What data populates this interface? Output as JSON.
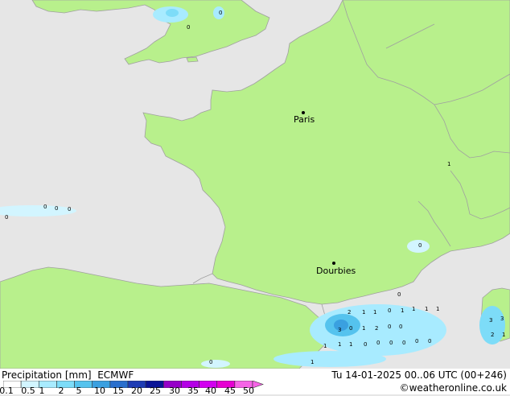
{
  "map": {
    "places": [
      {
        "name": "Paris"
      },
      {
        "name": "Dourbies"
      }
    ],
    "precip_labels": [
      "0",
      "0",
      "0",
      "0",
      "0",
      "0",
      "1",
      "0",
      "0",
      "2",
      "1",
      "1",
      "0",
      "1",
      "1",
      "1",
      "1",
      "3",
      "0",
      "1",
      "2",
      "0",
      "0",
      "1",
      "1",
      "1",
      "0",
      "0",
      "0",
      "0",
      "0",
      "0",
      "0",
      "1",
      "3",
      "3",
      "2",
      "1"
    ]
  },
  "footer": {
    "title": "Precipitation [mm]",
    "model": "ECMWF",
    "valid_time": "Tu 14-01-2025 00..06 UTC (00+246)",
    "credit": "©weatheronline.co.uk",
    "legend_ticks": [
      "0.1",
      "0.5",
      "1",
      "2",
      "5",
      "10",
      "15",
      "20",
      "25",
      "30",
      "35",
      "40",
      "45",
      "50"
    ],
    "legend_colors": [
      "#ffffff",
      "#d2f5ff",
      "#a8ebff",
      "#7ddcf8",
      "#55c3ee",
      "#3aa0e0",
      "#2a6fcd",
      "#1e3cb4",
      "#0a1496",
      "#9600c8",
      "#b400e6",
      "#d200f0",
      "#e600d2",
      "#f564e6"
    ]
  }
}
